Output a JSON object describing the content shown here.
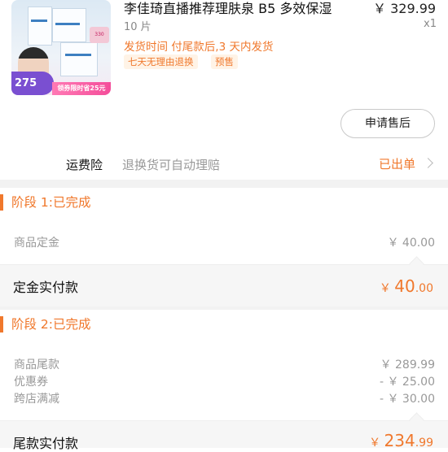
{
  "product": {
    "title": "李佳琦直播推荐理肤泉 B5 多效保湿",
    "price": "￥ 329.99",
    "quantity_label": "10 片",
    "quantity_count": "x1",
    "ship_info": "发货时间  付尾款后,3 天内发货",
    "tags": [
      "七天无理由退换",
      "预售"
    ],
    "thumbnail": {
      "price_bubble": "275",
      "coupon_text": "领券限时省25元",
      "badge_text": "330"
    }
  },
  "after_sale_button": "申请售后",
  "insurance": {
    "label": "运费险",
    "description": "退换货可自动理赔",
    "status": "已出单"
  },
  "stage1": {
    "title": "阶段 1:已完成",
    "rows": [
      {
        "label": "商品定金",
        "value": "￥ 40.00"
      }
    ],
    "paid_label": "定金实付款",
    "paid_yen": "￥ ",
    "paid_int": "40",
    "paid_dec": ".00"
  },
  "stage2": {
    "title": "阶段 2:已完成",
    "rows": [
      {
        "label": "商品尾款",
        "value": "￥ 289.99"
      },
      {
        "label": "优惠券",
        "value": "- ￥ 25.00"
      },
      {
        "label": "跨店满减",
        "value": "- ￥ 30.00"
      }
    ],
    "paid_label": "尾款实付款",
    "paid_yen": "￥ ",
    "paid_int": "234",
    "paid_dec": ".99"
  },
  "colors": {
    "accent": "#f0782c",
    "muted": "#999999",
    "divider": "#f2f2f2"
  }
}
